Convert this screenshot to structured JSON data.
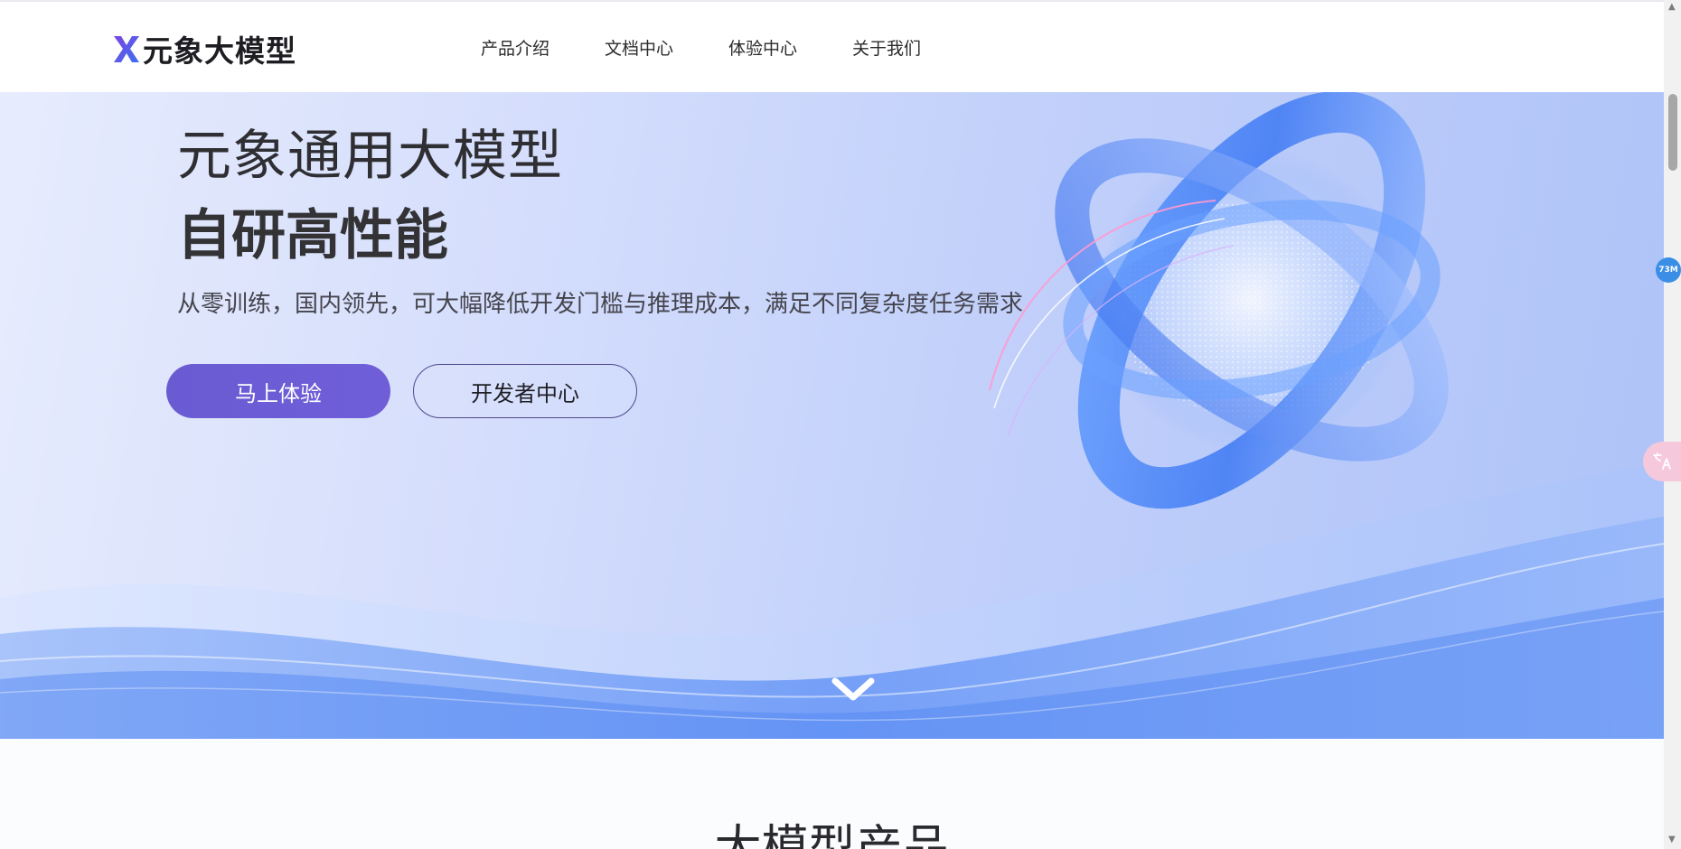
{
  "header": {
    "logo_text": "元象大模型",
    "logo_icon": "x-logo-icon",
    "nav": [
      {
        "label": "产品介绍"
      },
      {
        "label": "文档中心"
      },
      {
        "label": "体验中心"
      },
      {
        "label": "关于我们"
      }
    ]
  },
  "hero": {
    "title": "元象通用大模型",
    "subtitle": "自研高性能",
    "description": "从零训练，国内领先，可大幅降低开发门槛与推理成本，满足不同复杂度任务需求",
    "primary_button": "马上体验",
    "secondary_button": "开发者中心",
    "scroll_icon": "chevron-down-icon"
  },
  "section": {
    "title": "大模型产品"
  },
  "widgets": {
    "badge_text": "73M",
    "translate_icon": "translate-icon"
  },
  "colors": {
    "accent": "#6a5bd3",
    "logo_gradient_start": "#6b4ddb",
    "logo_gradient_end": "#3c6ef0"
  }
}
